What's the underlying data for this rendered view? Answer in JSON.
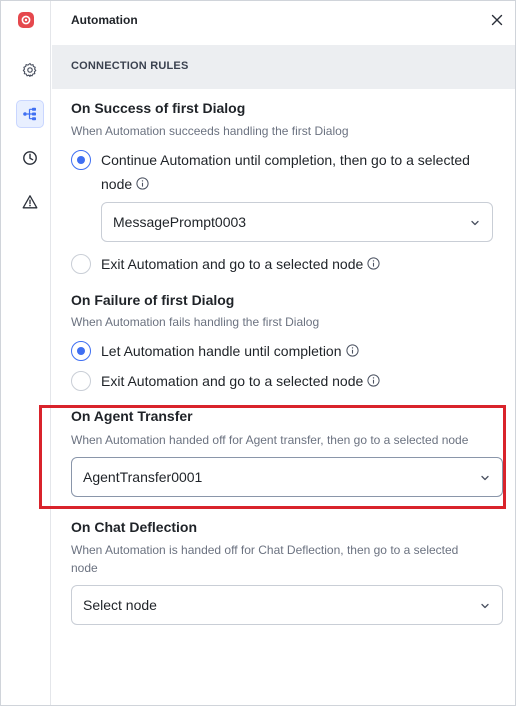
{
  "panel": {
    "title": "Automation",
    "section_title": "CONNECTION RULES"
  },
  "rail": {
    "logo_icon": "automation-logo-icon",
    "items": [
      "gear-icon",
      "flow-tree-icon",
      "clock-icon",
      "warning-icon"
    ],
    "active_index": 1
  },
  "success": {
    "title": "On Success of first Dialog",
    "description": "When Automation succeeds handling the first Dialog",
    "option_continue": "Continue Automation until completion, then go to a selected node",
    "option_continue_line1": "Continue Automation until completion, then go to a selected",
    "option_continue_line2": "node",
    "select_value": "MessagePrompt0003",
    "option_exit": "Exit Automation and go to a selected node",
    "selected": "continue"
  },
  "failure": {
    "title": "On Failure of first Dialog",
    "description": "When Automation fails handling the first Dialog",
    "option_handle": "Let Automation handle until completion",
    "option_exit": "Exit Automation and go to a selected node",
    "selected": "handle"
  },
  "agent_transfer": {
    "title": "On Agent Transfer",
    "description": "When Automation handed off for Agent transfer, then go to a selected node",
    "select_value": "AgentTransfer0001"
  },
  "chat_deflection": {
    "title": "On Chat Deflection",
    "description_line1": "When Automation is handed off for Chat Deflection, then go to a selected",
    "description_line2": "node",
    "select_value": "Select node"
  },
  "colors": {
    "accent": "#3f6ff2",
    "highlight_box": "#d9232b",
    "section_band": "#eceef1"
  }
}
